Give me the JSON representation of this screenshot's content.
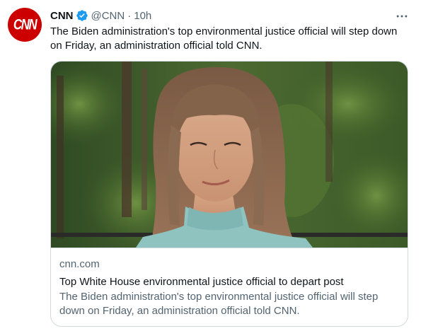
{
  "tweet": {
    "avatar_text": "CNN",
    "display_name": "CNN",
    "handle": "@CNN",
    "separator": "·",
    "time": "10h",
    "text": "The Biden administration's top environmental justice official will step down on Friday, an administration official told CNN.",
    "more_icon": "more-horizontal-icon",
    "verified_icon": "verified-badge-icon"
  },
  "card": {
    "domain": "cnn.com",
    "title": "Top White House environmental justice official to depart post",
    "description": "The Biden administration's top environmental justice official will step down on Friday, an administration official told CNN."
  },
  "colors": {
    "brand": "#cc0000",
    "verified": "#1d9bf0",
    "secondary_text": "#536471",
    "border": "#cfd9de"
  }
}
